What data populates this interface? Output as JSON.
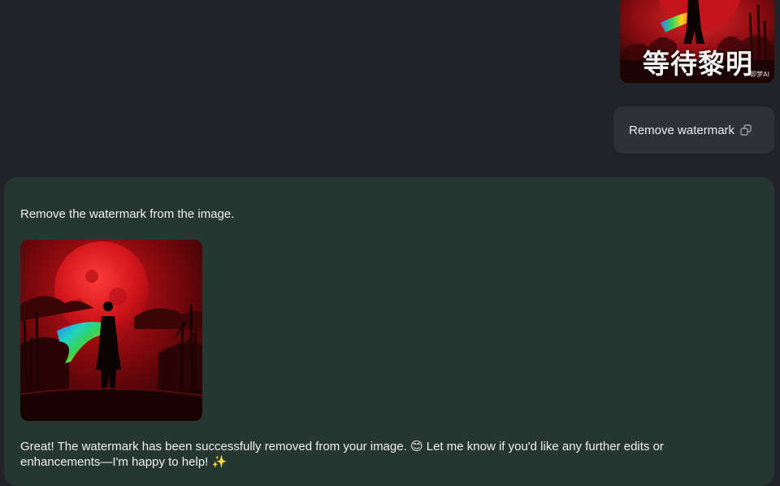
{
  "user": {
    "image": {
      "alt": "Red moon scene with silhouetted figure and rainbow scarf",
      "watermark_text": "等待黎明",
      "watermark_badge": "即梦AI"
    },
    "message": "Remove watermark",
    "icon": "edit-icon"
  },
  "assistant": {
    "intro": "Remove the watermark from the image.",
    "image": {
      "alt": "Red moon scene with silhouetted figure and rainbow scarf, watermark removed"
    },
    "reply_part1": "Great! The watermark has been successfully removed from your image.",
    "reply_emoji1": "😊",
    "reply_part2": "Let me know if you'd like any further edits or enhancements—I'm happy to help!",
    "reply_emoji2": "✨"
  },
  "colors": {
    "background": "#212328",
    "user_bubble": "#2e3138",
    "assistant_card": "#263631",
    "moon": "#c8141b"
  }
}
